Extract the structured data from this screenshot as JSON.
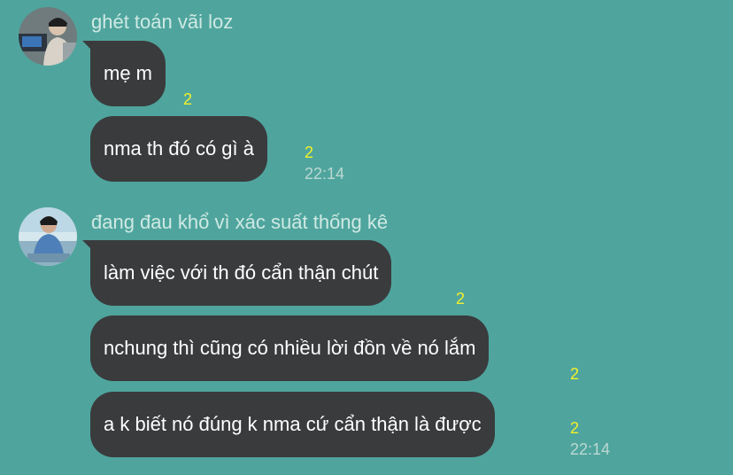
{
  "colors": {
    "background": "#4fa59d",
    "bubble": "#3a3b3d",
    "read_count": "#f3f02a",
    "sender_name": "#cfe9e4",
    "timestamp": "#bcd8d3"
  },
  "groups": [
    {
      "sender": "ghét toán vãi loz",
      "avatar_icon": "user-avatar-icon",
      "messages": [
        {
          "text": "mẹ m",
          "read_count": "2"
        },
        {
          "text": "nma th đó có gì à",
          "read_count": "2",
          "time": "22:14"
        }
      ]
    },
    {
      "sender": "đang đau khổ vì xác suất thống kê",
      "avatar_icon": "user-avatar-icon",
      "messages": [
        {
          "text": "làm việc với th đó cẩn thận chút",
          "read_count": "2"
        },
        {
          "text": "nchung thì cũng có nhiều lời đồn về nó lắm",
          "read_count": "2"
        },
        {
          "text": "a k biết nó đúng k nma cứ cẩn thận là được",
          "read_count": "2",
          "time": "22:14"
        }
      ]
    }
  ]
}
